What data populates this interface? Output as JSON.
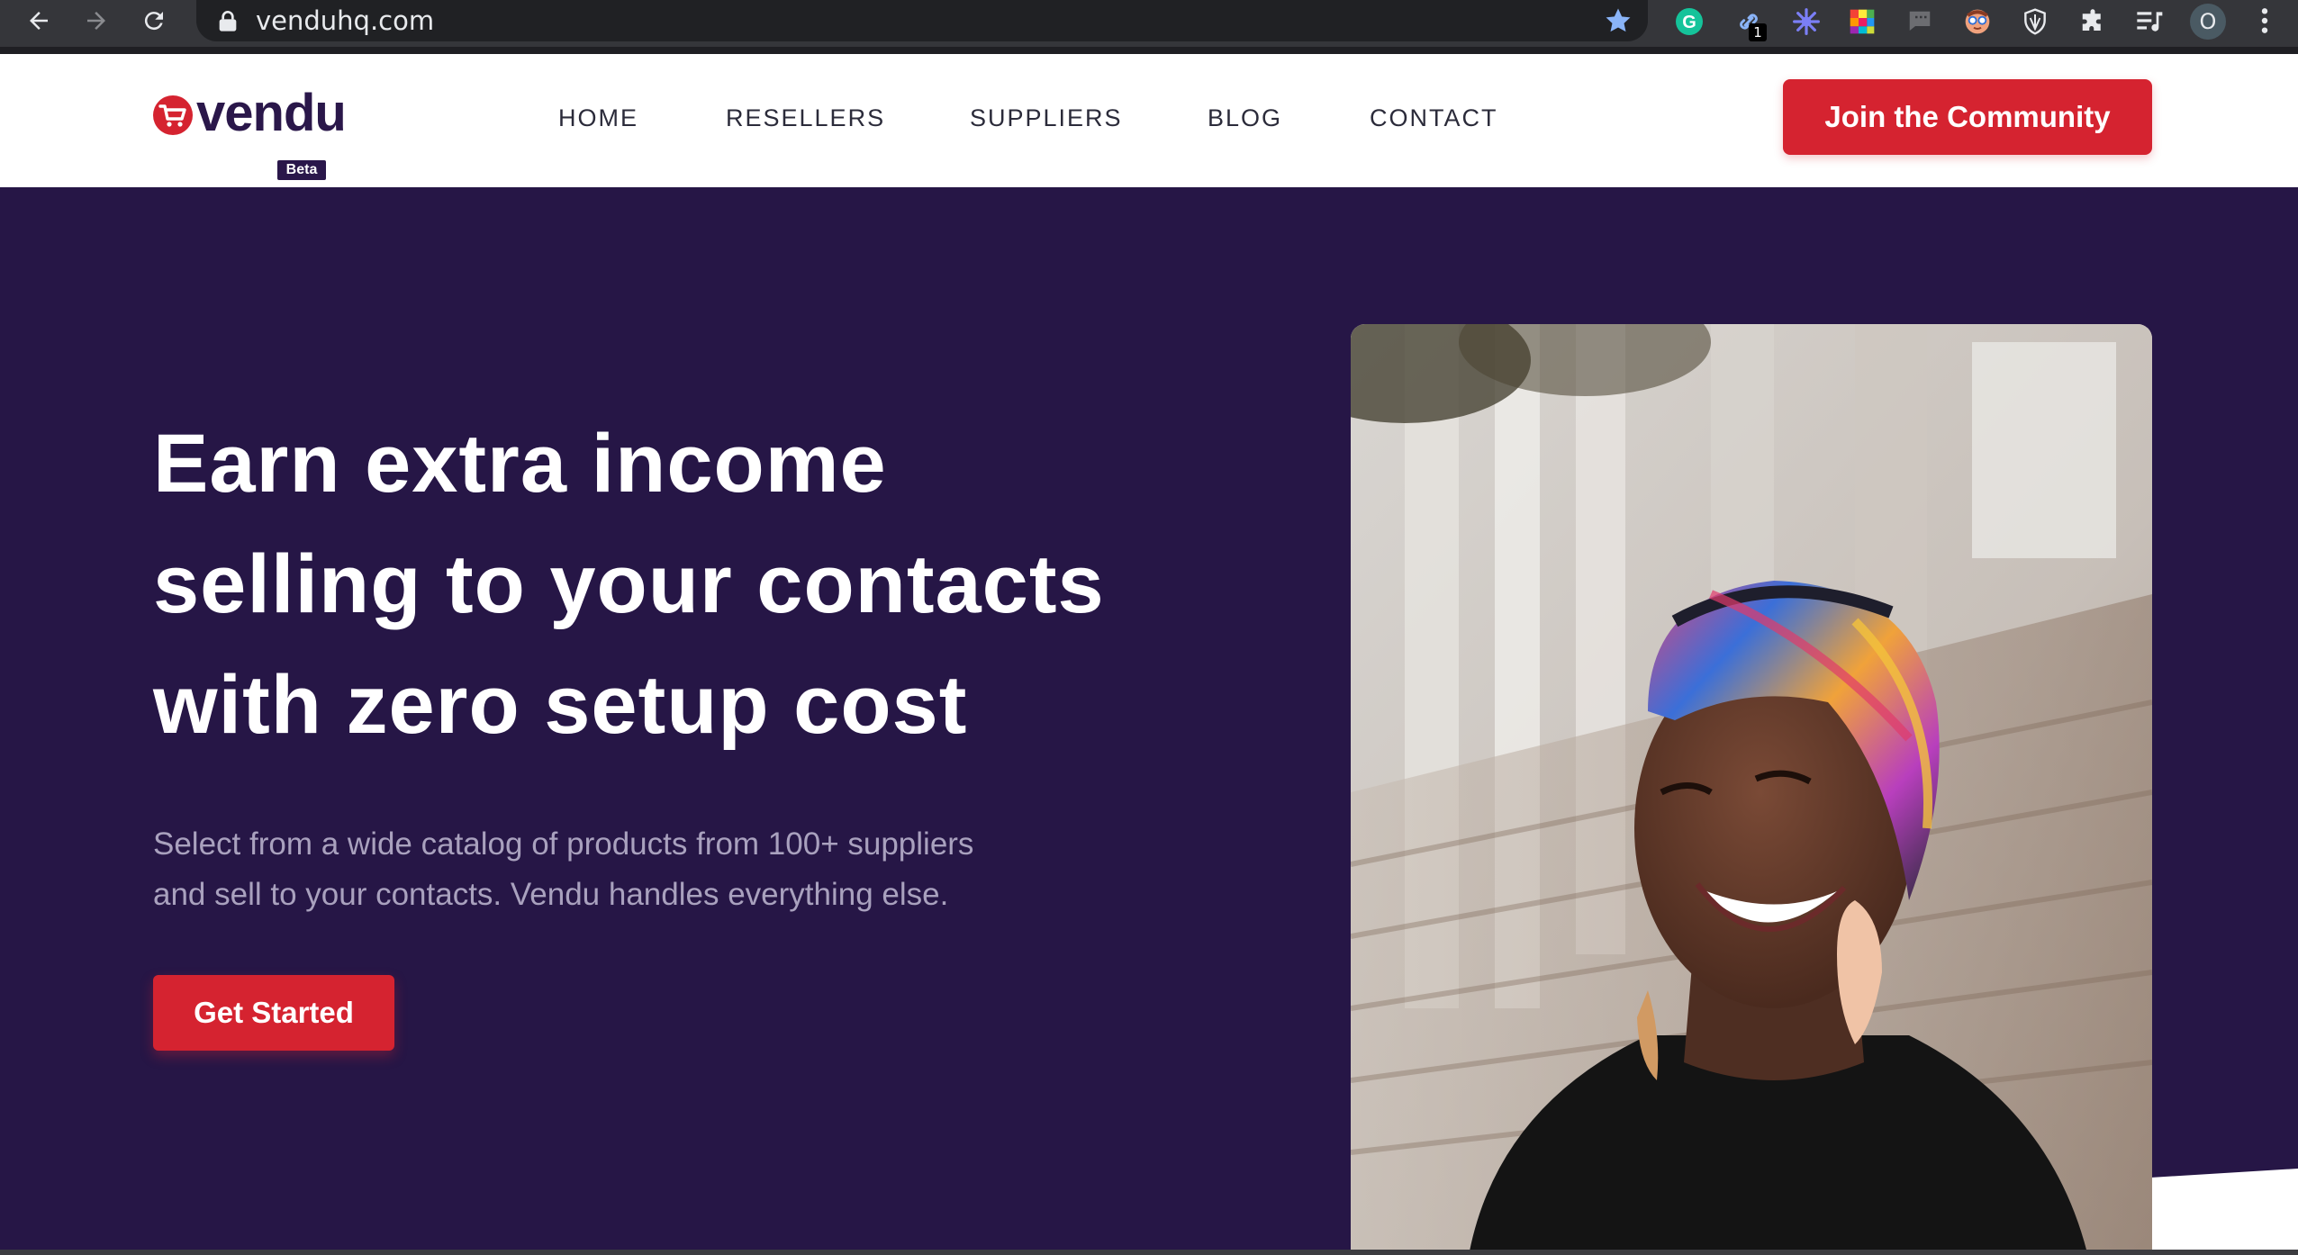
{
  "browser": {
    "url": "venduhq.com",
    "extension_badge": "1",
    "profile_initial": "O"
  },
  "brand": {
    "name": "vendu",
    "tag": "Beta",
    "colors": {
      "primary": "#261646",
      "accent": "#d52330",
      "text_muted": "#a9a1be"
    }
  },
  "nav": {
    "items": [
      {
        "label": "HOME"
      },
      {
        "label": "RESELLERS"
      },
      {
        "label": "SUPPLIERS"
      },
      {
        "label": "BLOG"
      },
      {
        "label": "CONTACT"
      }
    ],
    "cta_label": "Join the Community"
  },
  "hero": {
    "headline_lines": [
      "Earn extra income",
      "selling to your contacts",
      "with zero setup cost"
    ],
    "subtext_lines": [
      "Select from a wide catalog of products from 100+ suppliers",
      "and sell to your contacts. Vendu handles everything else."
    ],
    "cta_label": "Get Started"
  },
  "icons": {
    "back": "arrow-left-icon",
    "forward": "arrow-right-icon",
    "reload": "reload-icon",
    "lock": "lock-icon",
    "bookmark": "star-icon",
    "extensions": [
      "grammarly-icon",
      "link-icon",
      "sparkle-icon",
      "color-palette-icon",
      "chat-icon",
      "face-icon",
      "shield-icon",
      "puzzle-icon",
      "media-queue-icon"
    ],
    "menu": "more-vertical-icon"
  }
}
